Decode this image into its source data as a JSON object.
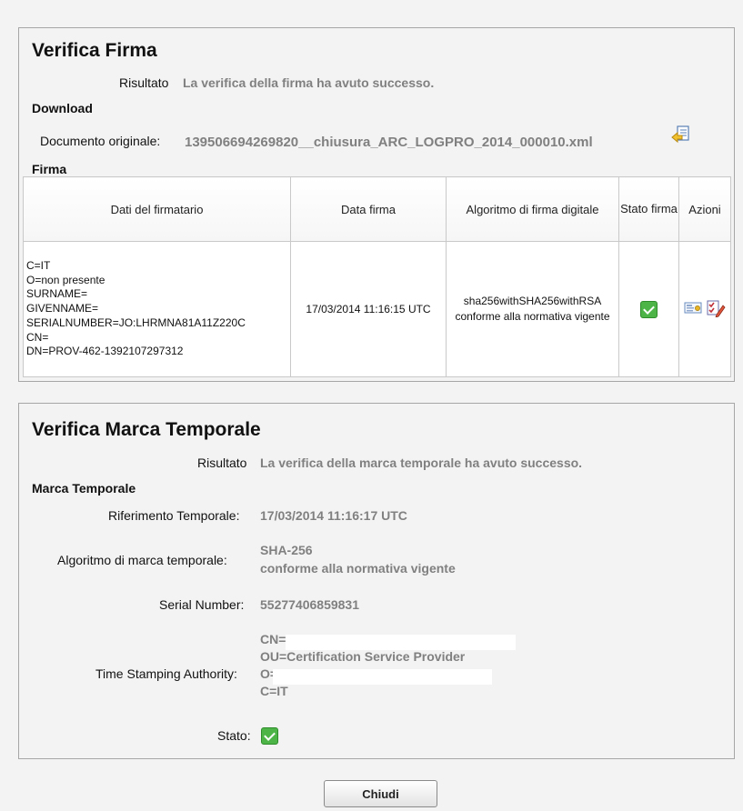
{
  "firma_panel": {
    "title": "Verifica Firma",
    "risultato_label": "Risultato",
    "risultato_value": "La verifica della firma ha avuto successo.",
    "download_section": "Download",
    "documento_label": "Documento originale:",
    "documento_value": "139506694269820__chiusura_ARC_LOGPRO_2014_000010.xml",
    "firma_section": "Firma",
    "table": {
      "headers": [
        "Dati del firmatario",
        "Data firma",
        "Algoritmo di firma digitale",
        "Stato firma",
        "Azioni"
      ],
      "row": {
        "signer": [
          "C=IT",
          "O=non presente",
          "SURNAME=",
          "GIVENNAME=",
          "SERIALNUMBER=JO:LHRMNA81A11Z220C",
          "CN=",
          "DN=PROV-462-1392107297312"
        ],
        "data_firma": "17/03/2014 11:16:15 UTC",
        "algoritmo": "sha256withSHA256withRSA conforme alla normativa vigente",
        "stato": "ok"
      }
    }
  },
  "marca_panel": {
    "title": "Verifica Marca Temporale",
    "risultato_label": "Risultato",
    "risultato_value": "La verifica della marca temporale ha avuto successo.",
    "section": "Marca Temporale",
    "rif_label": "Riferimento Temporale:",
    "rif_value": "17/03/2014 11:16:17 UTC",
    "alg_label": "Algoritmo di marca temporale:",
    "alg_value_1": "SHA-256",
    "alg_value_2": "conforme alla normativa vigente",
    "serial_label": "Serial Number:",
    "serial_value": "55277406859831",
    "tsa_label": "Time Stamping Authority:",
    "tsa_lines": [
      "CN=",
      "OU=Certification Service Provider",
      "O=",
      "C=IT"
    ],
    "stato_label": "Stato:",
    "stato": "ok"
  },
  "close_button": "Chiudi",
  "colors": {
    "success": "#4db548",
    "value_gray": "#808080"
  }
}
